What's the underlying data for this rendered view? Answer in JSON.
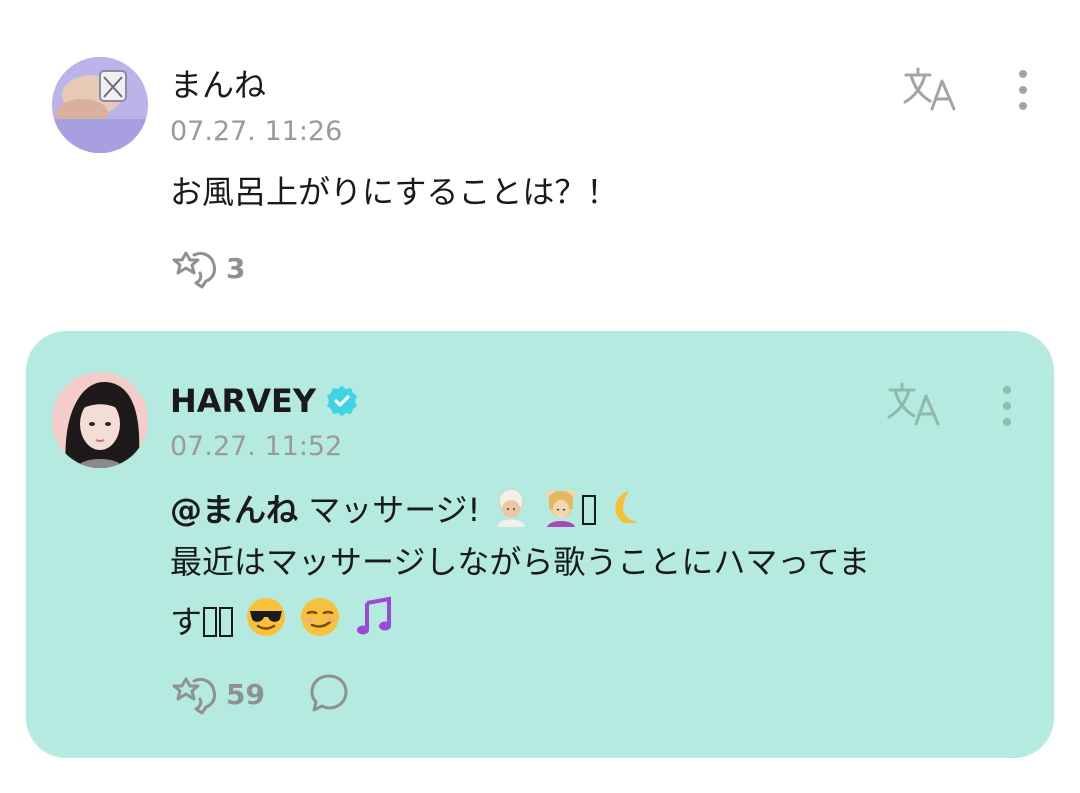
{
  "comment": {
    "author": "まんね",
    "timestamp": "07.27. 11:26",
    "text": "お風呂上がりにすることは？！",
    "like_count": "3"
  },
  "reply": {
    "author": "HARVEY",
    "verified": true,
    "timestamp": "07.27. 11:52",
    "mention": "@まんね",
    "line1_text": " マッサージ!",
    "line2_text": "最近はマッサージしながら歌うことにハマってま",
    "line3_text": "す",
    "like_count": "59"
  },
  "icons": {
    "translate": "translate-icon",
    "more": "more-vertical-icon",
    "like": "star-hand-icon",
    "reply": "speech-bubble-icon",
    "verified": "verified-badge-icon"
  },
  "colors": {
    "reply_background": "#b5eae0",
    "verified_badge": "#3fd3e3",
    "muted_text": "#9a9a9a",
    "icon_gray": "#8f9190"
  }
}
